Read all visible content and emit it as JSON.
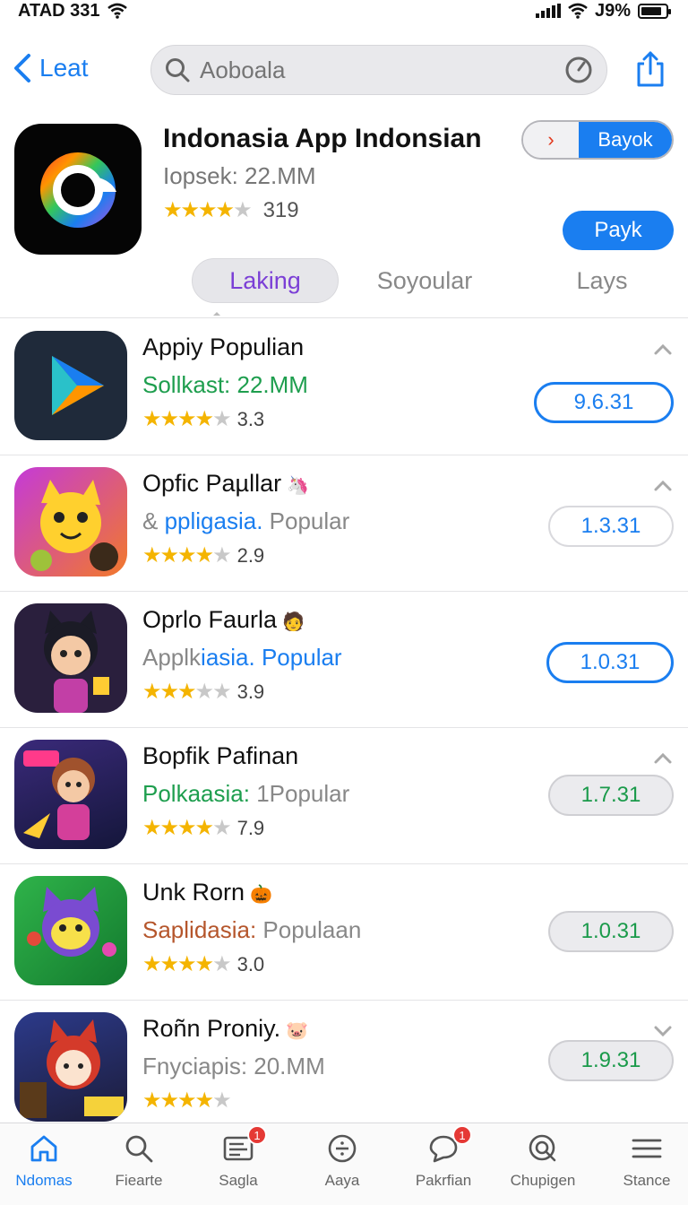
{
  "status_bar": {
    "carrier": "ATAD 331",
    "battery": "J9%"
  },
  "nav": {
    "back_label": "Leat",
    "search_placeholder": "Aoboala"
  },
  "app": {
    "title": "Indonasia App  Indonsian",
    "subtitle": "Iopsek: 22.MM",
    "rating_count": "319",
    "rating": 3.5,
    "toggle_label": "Bayok",
    "action_label": "Payk"
  },
  "tabs": [
    {
      "label": "Laking",
      "active": true
    },
    {
      "label": "Soyoular",
      "active": false
    },
    {
      "label": "Lays",
      "active": false
    }
  ],
  "list": [
    {
      "title": "Appiy Populian",
      "emoji": "",
      "sub_a": "Sollkast: 22.MM",
      "sub_a_color": "#1e9e4e",
      "sub_b": "",
      "sub_b_color": "",
      "rating_value": "3.3",
      "stars": 3.5,
      "version": "9.6.31",
      "pill": "outline",
      "chevron": "up"
    },
    {
      "title": "Opfic Paµllar",
      "emoji": "🦄",
      "sub_a": "& ",
      "sub_a_color": "#888",
      "sub_b": "ppligasia.",
      "sub_b_color": "#1a7ef0",
      "sub_c": " Popular",
      "sub_c_color": "#888",
      "rating_value": "2.9",
      "stars": 3.5,
      "version": "1.3.31",
      "pill": "light",
      "chevron": "up"
    },
    {
      "title": "Oprlo Faurla",
      "emoji": "🧑",
      "sub_a": "Applk",
      "sub_a_color": "#888",
      "sub_b": "iasia. Popular",
      "sub_b_color": "#1a7ef0",
      "sub_c": "",
      "sub_c_color": "",
      "rating_value": "3.9",
      "stars": 3,
      "version": "1.0.31",
      "pill": "outline",
      "chevron": ""
    },
    {
      "title": "Bopfik Pafinan",
      "emoji": "",
      "sub_a": "Polkaasia: ",
      "sub_a_color": "#1e9e4e",
      "sub_b": "1Popular",
      "sub_b_color": "#888",
      "sub_c": "",
      "sub_c_color": "",
      "rating_value": "7.9",
      "stars": 3.5,
      "version": "1.7.31",
      "pill": "gray",
      "chevron": "up"
    },
    {
      "title": "Unk Rorn",
      "emoji": "🎃",
      "sub_a": "Saplidasia: ",
      "sub_a_color": "#b5562c",
      "sub_b": "Populaan",
      "sub_b_color": "#888",
      "sub_c": "",
      "sub_c_color": "",
      "rating_value": "3.0",
      "stars": 3.5,
      "version": "1.0.31",
      "pill": "gray",
      "chevron": ""
    },
    {
      "title": "Roñn Proniy.",
      "emoji": "🐷",
      "sub_a": "Fnyciapis: 20.MM",
      "sub_a_color": "#888",
      "sub_b": "",
      "sub_b_color": "",
      "sub_c": "",
      "sub_c_color": "",
      "rating_value": "",
      "stars": 3.5,
      "version": "1.9.31",
      "pill": "gray",
      "chevron": "down"
    }
  ],
  "tab_bar": [
    {
      "label": "Ndomas",
      "icon": "home-icon",
      "active": true,
      "badge": ""
    },
    {
      "label": "Fiearte",
      "icon": "search-icon",
      "active": false,
      "badge": ""
    },
    {
      "label": "Sagla",
      "icon": "news-icon",
      "active": false,
      "badge": "1"
    },
    {
      "label": "Aaya",
      "icon": "compass-icon",
      "active": false,
      "badge": ""
    },
    {
      "label": "Pakrfian",
      "icon": "chat-icon",
      "active": false,
      "badge": "1"
    },
    {
      "label": "Chupigen",
      "icon": "search-circle-icon",
      "active": false,
      "badge": ""
    },
    {
      "label": "Stance",
      "icon": "menu-icon",
      "active": false,
      "badge": ""
    }
  ],
  "colors": {
    "accent": "#1a7ef0",
    "tab_active": "#7b3fd6",
    "star": "#f4b400"
  }
}
